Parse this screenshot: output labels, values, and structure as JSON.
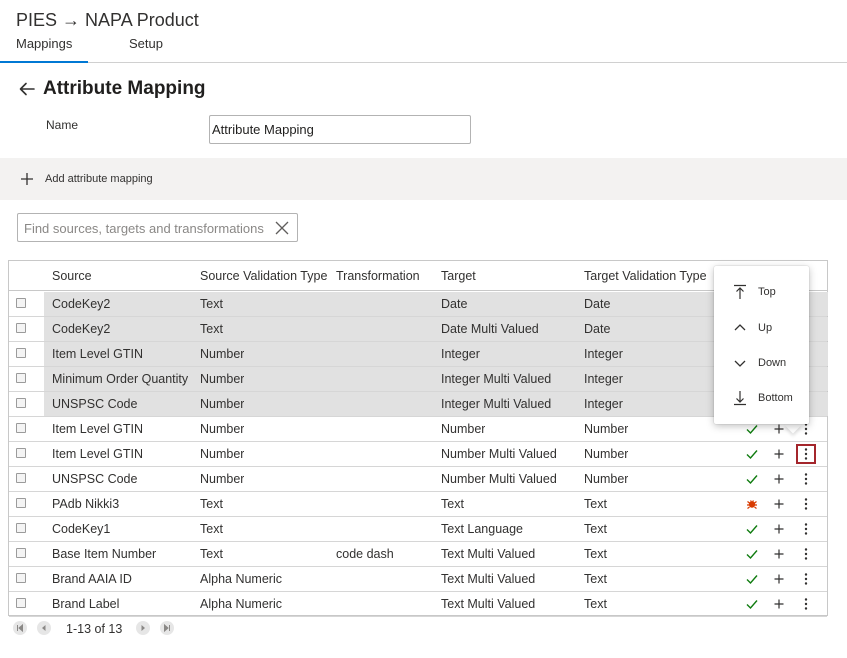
{
  "app": {
    "title": "PIES → NAPA Product",
    "tabs": [
      {
        "label": "Mappings",
        "active": true
      },
      {
        "label": "Setup",
        "active": false
      }
    ]
  },
  "page": {
    "title": "Attribute Mapping",
    "name_label": "Name",
    "name_value": "Attribute Mapping"
  },
  "command_bar": {
    "add_label": "Add attribute mapping"
  },
  "search": {
    "placeholder": "Find sources, targets and transformations",
    "value": ""
  },
  "grid": {
    "columns": [
      "Source",
      "Source Validation Type",
      "Transformation",
      "Target",
      "Target Validation Type"
    ],
    "rows": [
      {
        "source": "CodeKey2",
        "source_type": "Text",
        "transformation": "",
        "target": "Date",
        "target_type": "Date",
        "selected": true,
        "status": "ok"
      },
      {
        "source": "CodeKey2",
        "source_type": "Text",
        "transformation": "",
        "target": "Date Multi Valued",
        "target_type": "Date",
        "selected": true,
        "status": "ok"
      },
      {
        "source": "Item Level GTIN",
        "source_type": "Number",
        "transformation": "",
        "target": "Integer",
        "target_type": "Integer",
        "selected": true,
        "status": "ok"
      },
      {
        "source": "Minimum Order Quantity",
        "source_type": "Number",
        "transformation": "",
        "target": "Integer Multi Valued",
        "target_type": "Integer",
        "selected": true,
        "status": "ok"
      },
      {
        "source": "UNSPSC Code",
        "source_type": "Number",
        "transformation": "",
        "target": "Integer Multi Valued",
        "target_type": "Integer",
        "selected": true,
        "status": "ok"
      },
      {
        "source": "Item Level GTIN",
        "source_type": "Number",
        "transformation": "",
        "target": "Number",
        "target_type": "Number",
        "selected": false,
        "status": "ok"
      },
      {
        "source": "Item Level GTIN",
        "source_type": "Number",
        "transformation": "",
        "target": "Number Multi Valued",
        "target_type": "Number",
        "selected": false,
        "status": "ok",
        "menu_open": true
      },
      {
        "source": "UNSPSC Code",
        "source_type": "Number",
        "transformation": "",
        "target": "Number Multi Valued",
        "target_type": "Number",
        "selected": false,
        "status": "ok"
      },
      {
        "source": "PAdb Nikki3",
        "source_type": "Text",
        "transformation": "",
        "target": "Text",
        "target_type": "Text",
        "selected": false,
        "status": "warning"
      },
      {
        "source": "CodeKey1",
        "source_type": "Text",
        "transformation": "",
        "target": "Text Language",
        "target_type": "Text",
        "selected": false,
        "status": "ok"
      },
      {
        "source": "Base Item Number",
        "source_type": "Text",
        "transformation": "code dash",
        "target": "Text Multi Valued",
        "target_type": "Text",
        "selected": false,
        "status": "ok"
      },
      {
        "source": "Brand AAIA ID",
        "source_type": "Alpha Numeric",
        "transformation": "",
        "target": "Text Multi Valued",
        "target_type": "Text",
        "selected": false,
        "status": "ok"
      },
      {
        "source": "Brand Label",
        "source_type": "Alpha Numeric",
        "transformation": "",
        "target": "Text Multi Valued",
        "target_type": "Text",
        "selected": false,
        "status": "ok"
      }
    ]
  },
  "pager": {
    "text": "1-13 of 13"
  },
  "move_menu": {
    "items": [
      {
        "label": "Top",
        "icon": "move-top-icon"
      },
      {
        "label": "Up",
        "icon": "chevron-up-icon"
      },
      {
        "label": "Down",
        "icon": "chevron-down-icon"
      },
      {
        "label": "Bottom",
        "icon": "move-bottom-icon"
      }
    ]
  },
  "colors": {
    "accent": "#0078d4",
    "ok": "#107c10",
    "warning": "#d83b01",
    "selected_row": "#e1e1e1",
    "command_bar": "#f3f2f1",
    "focus_outline": "#a4262c"
  }
}
